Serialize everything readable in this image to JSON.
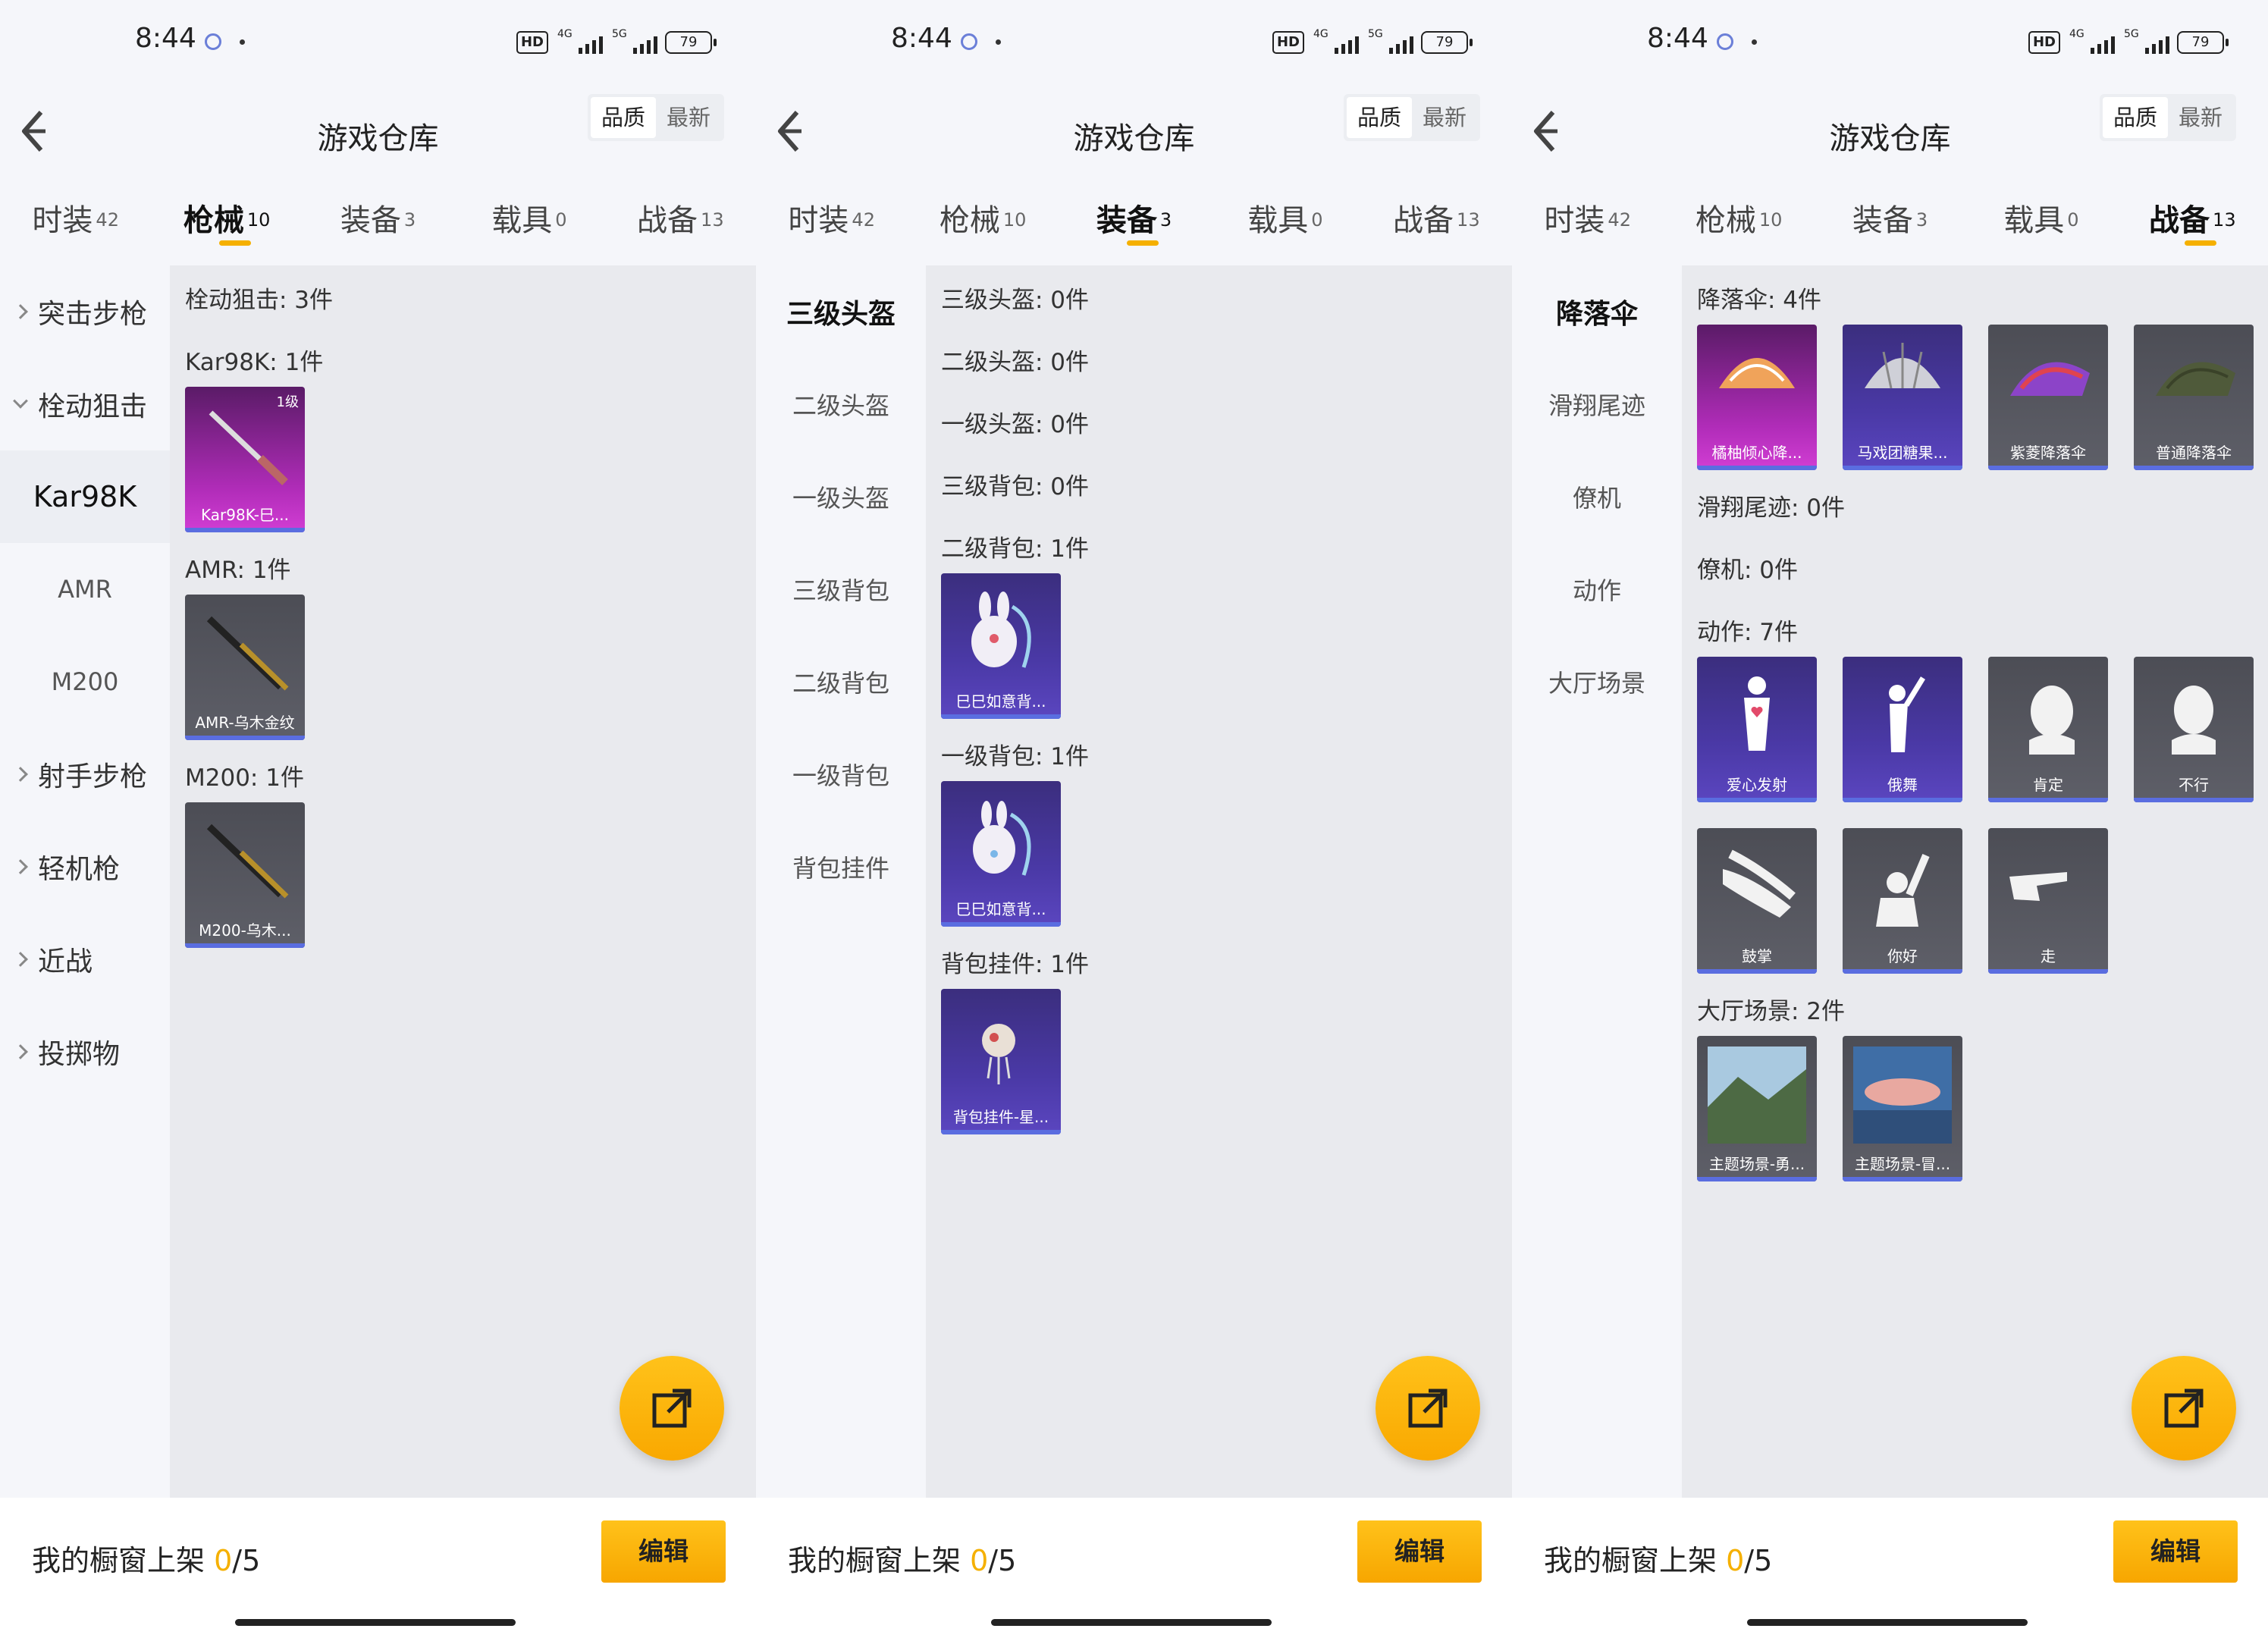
{
  "status": {
    "time": "8:44",
    "hd": "HD",
    "sig1": "4G",
    "sig2": "5G",
    "battery": "79"
  },
  "header": {
    "title": "游戏仓库",
    "sort_quality": "品质",
    "sort_newest": "最新"
  },
  "tabs": [
    {
      "label": "时装",
      "count": "42"
    },
    {
      "label": "枪械",
      "count": "10"
    },
    {
      "label": "装备",
      "count": "3"
    },
    {
      "label": "载具",
      "count": "0"
    },
    {
      "label": "战备",
      "count": "13"
    }
  ],
  "bottom": {
    "label": "我的橱窗上架",
    "current": "0",
    "total": "/5",
    "edit": "编辑"
  },
  "screen1": {
    "sidebar": [
      "突击步枪",
      "栓动狙击",
      "Kar98K",
      "AMR",
      "M200",
      "射手步枪",
      "轻机枪",
      "近战",
      "投掷物"
    ],
    "sections": [
      {
        "title": "栓动狙击: 3件"
      },
      {
        "title": "Kar98K: 1件",
        "items": [
          {
            "name": "Kar98K-巳...",
            "level": "1级"
          }
        ]
      },
      {
        "title": "AMR: 1件",
        "items": [
          {
            "name": "AMR-乌木金纹"
          }
        ]
      },
      {
        "title": "M200: 1件",
        "items": [
          {
            "name": "M200-乌木..."
          }
        ]
      }
    ]
  },
  "screen2": {
    "sidebar": [
      "三级头盔",
      "二级头盔",
      "一级头盔",
      "三级背包",
      "二级背包",
      "一级背包",
      "背包挂件"
    ],
    "sections": [
      {
        "title": "三级头盔: 0件"
      },
      {
        "title": "二级头盔: 0件"
      },
      {
        "title": "一级头盔: 0件"
      },
      {
        "title": "三级背包: 0件"
      },
      {
        "title": "二级背包: 1件",
        "items": [
          {
            "name": "巳巳如意背..."
          }
        ]
      },
      {
        "title": "一级背包: 1件",
        "items": [
          {
            "name": "巳巳如意背..."
          }
        ]
      },
      {
        "title": "背包挂件: 1件",
        "items": [
          {
            "name": "背包挂件-星..."
          }
        ]
      }
    ]
  },
  "screen3": {
    "sidebar": [
      "降落伞",
      "滑翔尾迹",
      "僚机",
      "动作",
      "大厅场景"
    ],
    "sections": [
      {
        "title": "降落伞: 4件",
        "items": [
          {
            "name": "橘柚倾心降..."
          },
          {
            "name": "马戏团糖果..."
          },
          {
            "name": "紫菱降落伞"
          },
          {
            "name": "普通降落伞"
          }
        ]
      },
      {
        "title": "滑翔尾迹: 0件"
      },
      {
        "title": "僚机: 0件"
      },
      {
        "title": "动作: 7件",
        "items": [
          {
            "name": "爱心发射"
          },
          {
            "name": "俄舞"
          },
          {
            "name": "肯定"
          },
          {
            "name": "不行"
          },
          {
            "name": "鼓掌"
          },
          {
            "name": "你好"
          },
          {
            "name": "走"
          }
        ]
      },
      {
        "title": "大厅场景: 2件",
        "items": [
          {
            "name": "主题场景-勇..."
          },
          {
            "name": "主题场景-冒..."
          }
        ]
      }
    ]
  }
}
